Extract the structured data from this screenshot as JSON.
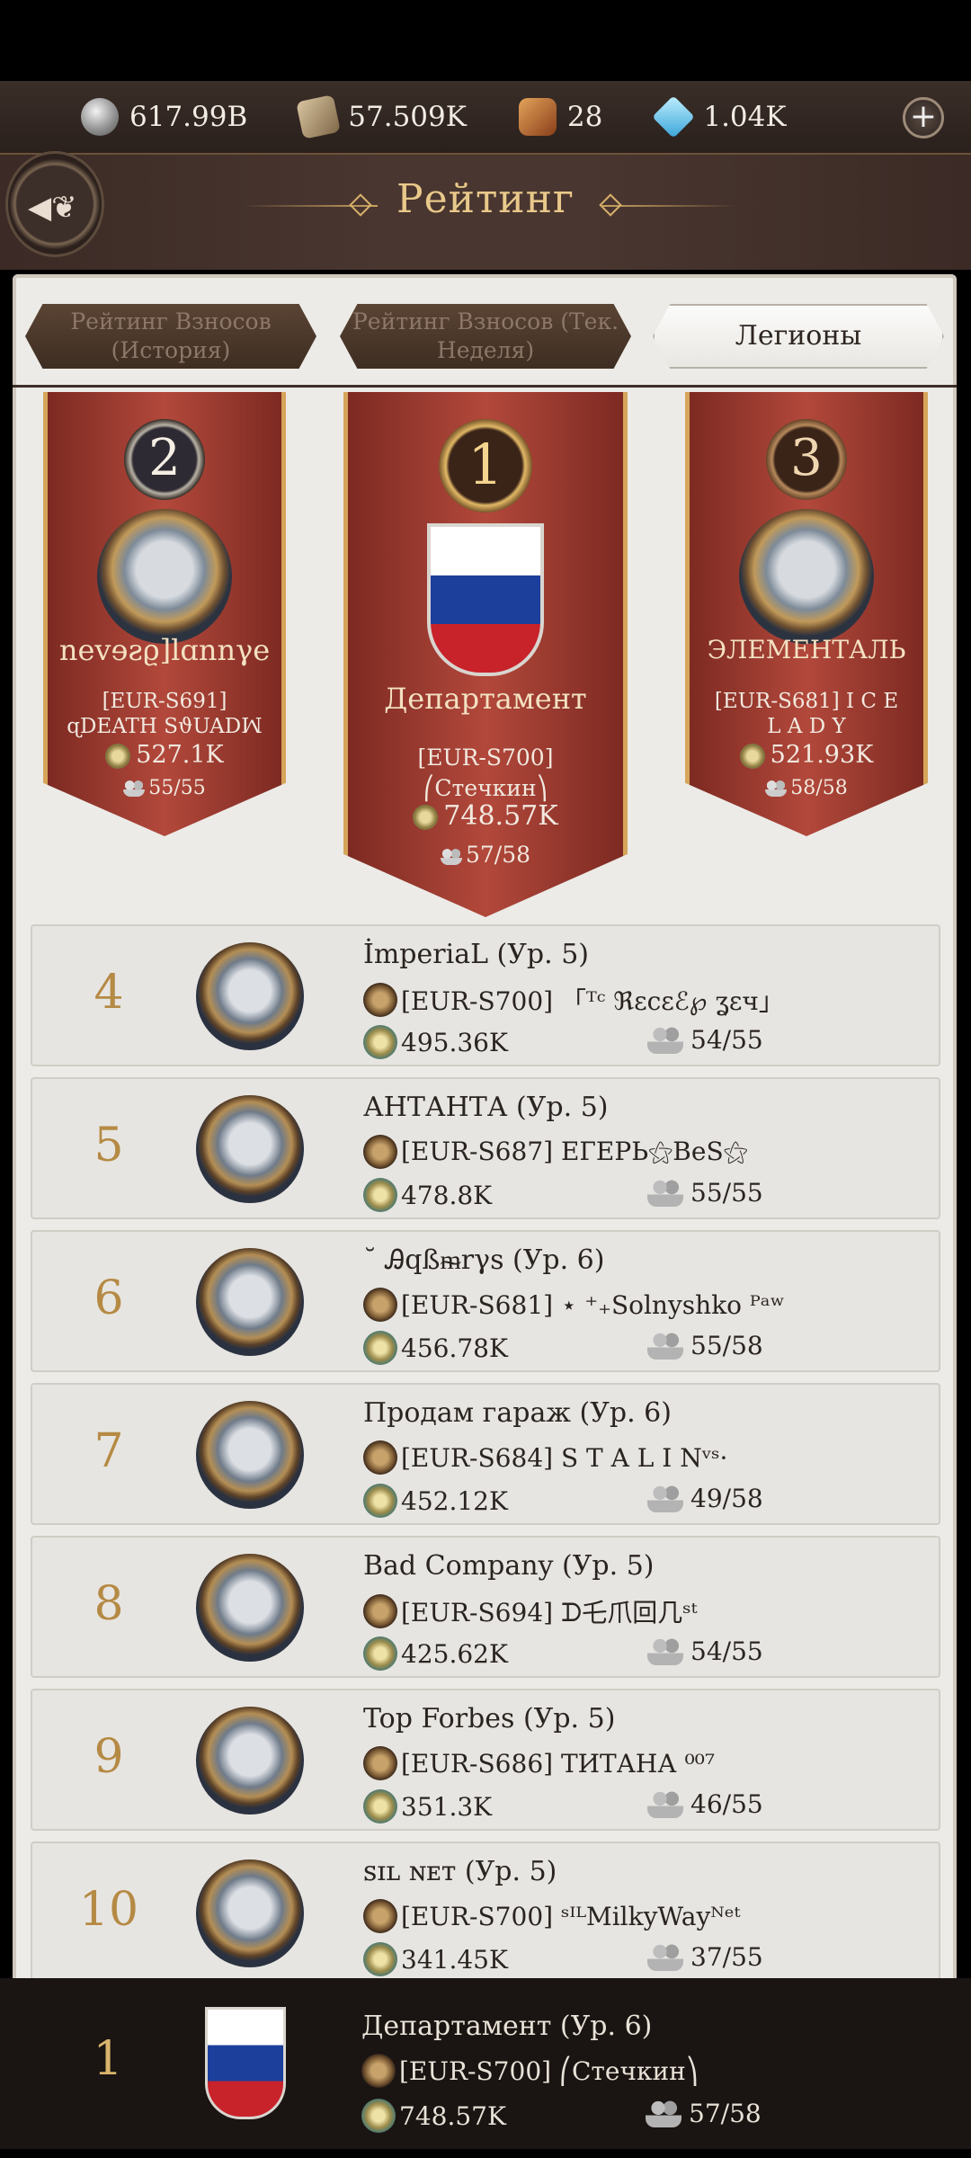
{
  "resources": [
    {
      "icon": "silver-coin-icon",
      "value": "617.99B"
    },
    {
      "icon": "scroll-icon",
      "value": "57.509K"
    },
    {
      "icon": "chest-icon",
      "value": "28"
    },
    {
      "icon": "crystal-icon",
      "value": "1.04K"
    }
  ],
  "header": {
    "title": "Рейтинг",
    "add_label": "+",
    "back_icon": "fleur-back-icon"
  },
  "tabs": [
    {
      "label": "Рейтинг Взносов (История)",
      "active": false
    },
    {
      "label": "Рейтинг Взносов (Тек. Неделя)",
      "active": false
    },
    {
      "label": "Легионы",
      "active": true
    }
  ],
  "podium": {
    "second": {
      "rank": "2",
      "name": "nevɘƨϱ]lɑnnγe",
      "leader": "[EUR-S691] ɋDEATH SϑUADꟽ",
      "power": "527.1K",
      "members": "55/55"
    },
    "first": {
      "rank": "1",
      "name": "Департамент",
      "leader": "[EUR-S700] ⎛Стечкин⎞",
      "power": "748.57K",
      "members": "57/58"
    },
    "third": {
      "rank": "3",
      "name": "ЭЛЕМЕНТАЛЬ",
      "leader": "[EUR-S681] I C E L A D Y",
      "power": "521.93K",
      "members": "58/58"
    }
  },
  "list": [
    {
      "rank": "4",
      "name": "İmperiaL (Ур. 5)",
      "leader": "[EUR-S700] 「ᵀᶜ ℜεϲεℰ℘ ʓεч」",
      "power": "495.36K",
      "members": "54/55"
    },
    {
      "rank": "5",
      "name": "АНТАНТА (Ур. 5)",
      "leader": "[EUR-S687] ЕГЕРЬ⚝BeS⚝",
      "power": "478.8K",
      "members": "55/55"
    },
    {
      "rank": "6",
      "name": "˘ Ꭿqßᵯrγs (Ур. 6)",
      "leader": "[EUR-S681] ⋆ ⁺₊Solnyshko ᴾᵃʷ",
      "power": "456.78K",
      "members": "55/58"
    },
    {
      "rank": "7",
      "name": "Продам гараж (Ур. 6)",
      "leader": "[EUR-S684] S T A L I Nᵛˢ·",
      "power": "452.12K",
      "members": "49/58"
    },
    {
      "rank": "8",
      "name": "Bad Company (Ур. 5)",
      "leader": "[EUR-S694] ᗪ乇爪回几ˢᵗ",
      "power": "425.62K",
      "members": "54/55"
    },
    {
      "rank": "9",
      "name": "Top Forbes (Ур. 5)",
      "leader": "[EUR-S686] ТИТАНА ⁰⁰⁷",
      "power": "351.3K",
      "members": "46/55"
    },
    {
      "rank": "10",
      "name": "ꜱɪʟ ɴᴇᴛ (Ур. 5)",
      "leader": "[EUR-S700] ˢᴵᴸMilkyWayᴺᵉᵗ",
      "power": "341.45K",
      "members": "37/55"
    }
  ],
  "own": {
    "rank": "1",
    "name": "Департамент (Ур. 6)",
    "leader": "[EUR-S700] ⎛Стечкин⎞",
    "power": "748.57K",
    "members": "57/58"
  }
}
